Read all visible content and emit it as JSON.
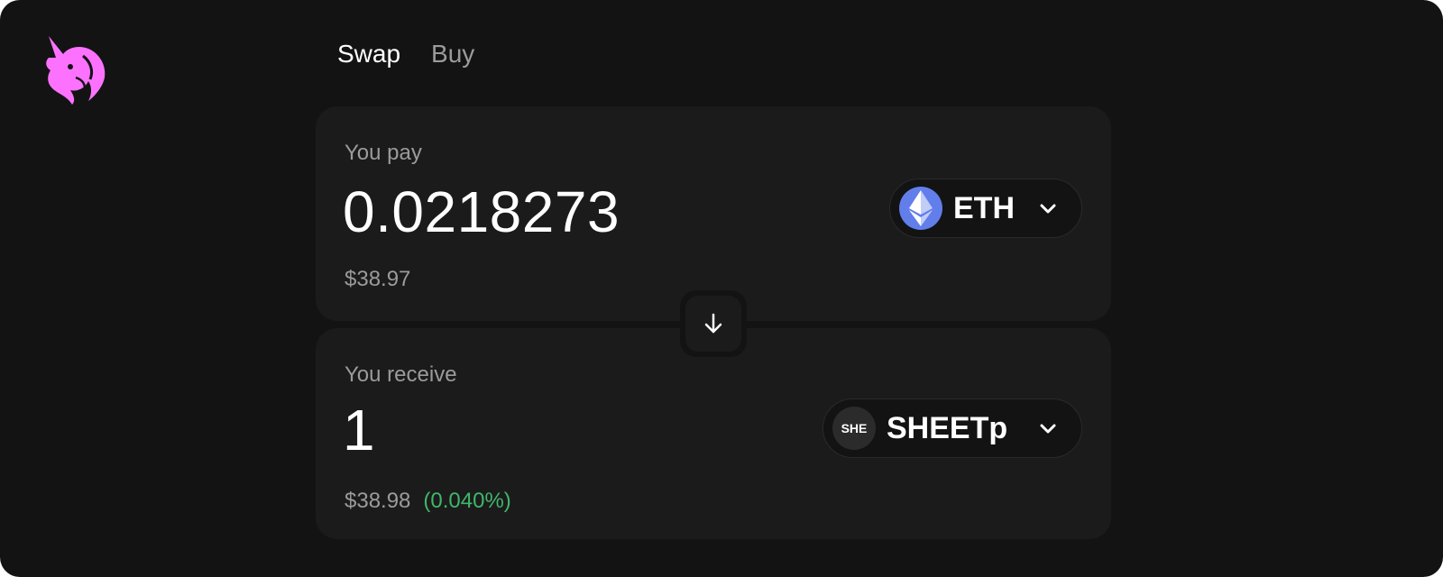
{
  "colors": {
    "background": "#131313",
    "panel": "#1b1b1b",
    "brand_pink": "#fc72ff",
    "eth_blue": "#627eea",
    "positive_green": "#40b66b",
    "secondary_text": "#9b9b9b"
  },
  "logo": {
    "icon": "uniswap-unicorn-icon"
  },
  "tabs": [
    {
      "label": "Swap",
      "active": true
    },
    {
      "label": "Buy",
      "active": false
    }
  ],
  "pay": {
    "label": "You pay",
    "amount": "0.0218273",
    "usd_value": "$38.97",
    "token": {
      "symbol": "ETH",
      "icon": "eth-icon"
    }
  },
  "switch": {
    "icon": "arrow-down-icon"
  },
  "receive": {
    "label": "You receive",
    "amount": "1",
    "usd_value": "$38.98",
    "price_impact": "(0.040%)",
    "token": {
      "symbol": "SHEETp",
      "logo_text": "SHE"
    }
  }
}
